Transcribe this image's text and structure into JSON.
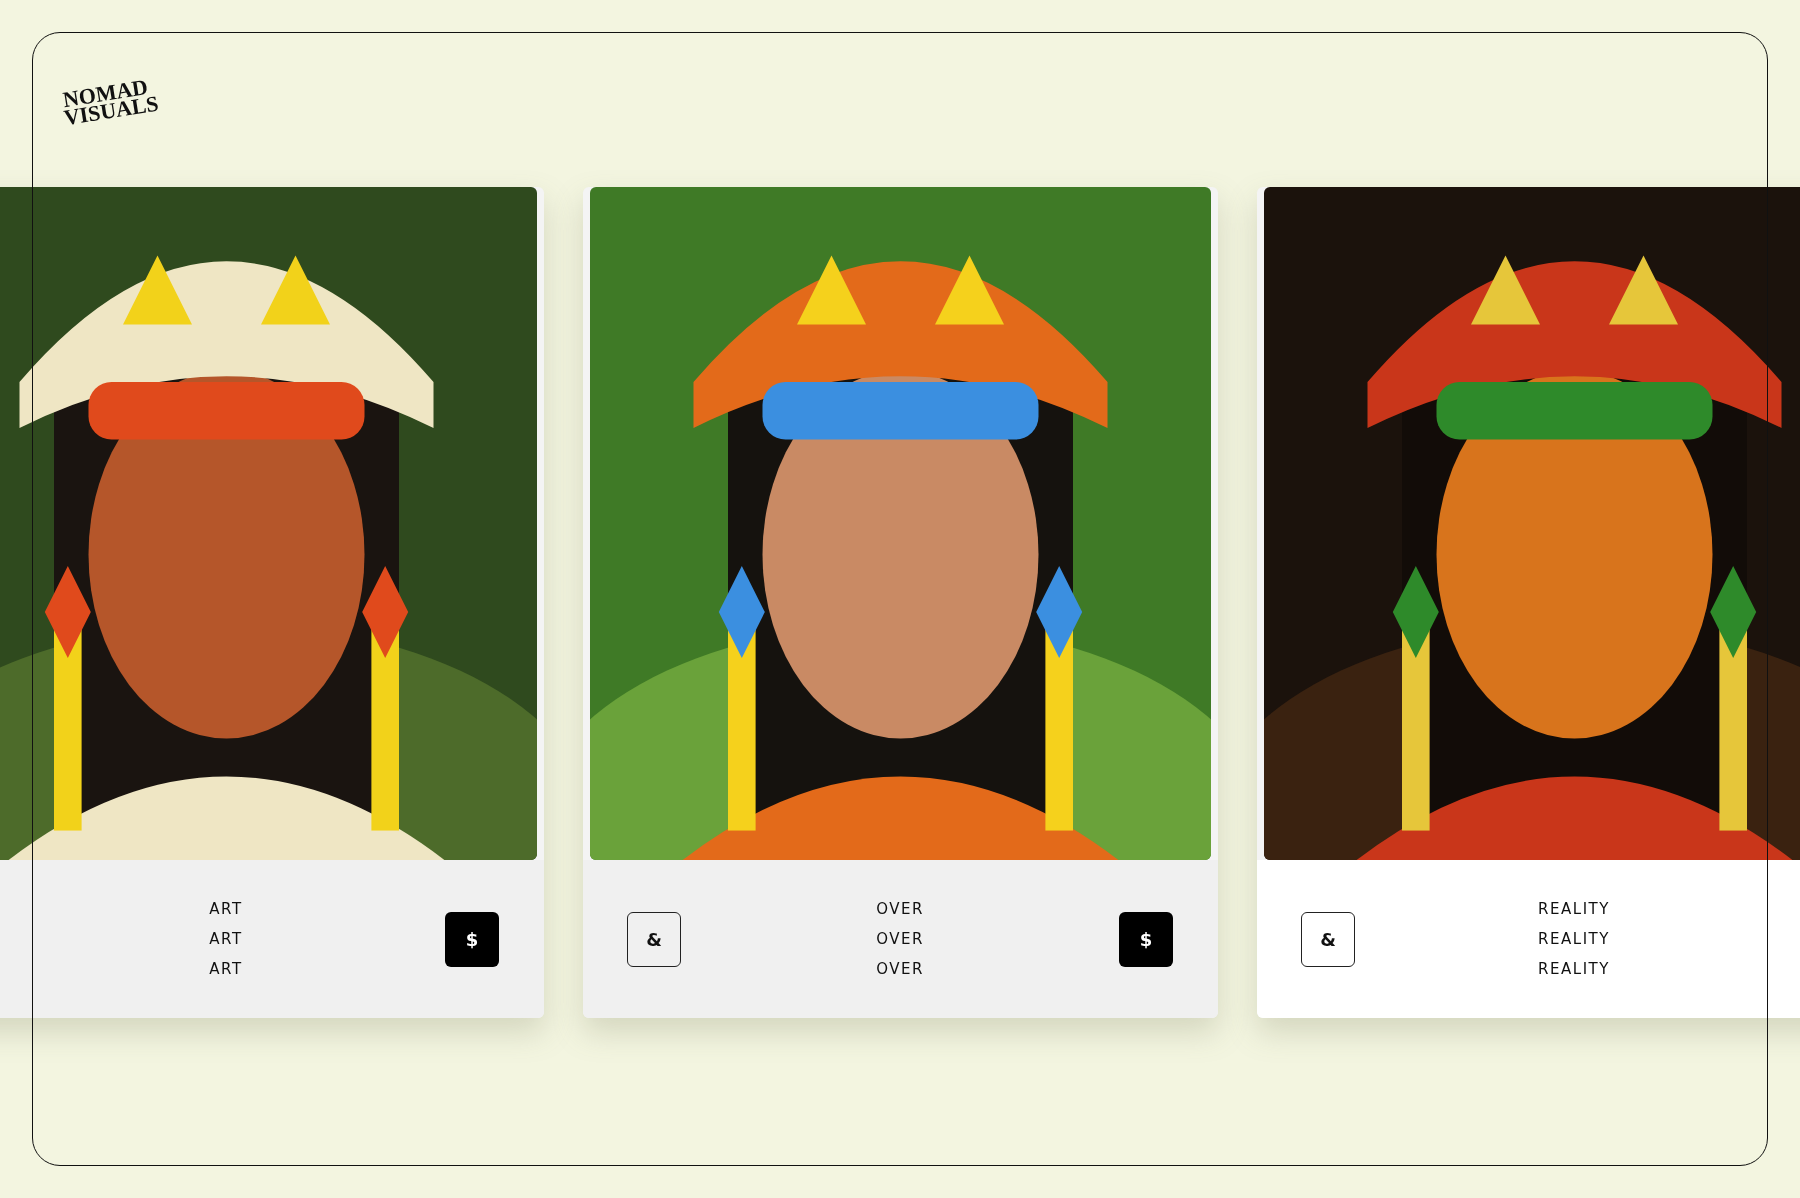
{
  "logo": {
    "lines": [
      "NOMAD",
      "VISUALS"
    ]
  },
  "cards": [
    {
      "image": {
        "kind": "picture"
      },
      "labels": [
        "ART",
        "ART",
        "ART"
      ],
      "highlighted": false,
      "buttons": [
        {
          "kind": "filled",
          "label": "$"
        }
      ]
    },
    {
      "image": {
        "kind": "picture"
      },
      "labels": [
        "OVER",
        "OVER",
        "OVER"
      ],
      "highlighted": false,
      "buttons": [
        {
          "kind": "outline",
          "label": "&"
        },
        {
          "kind": "filled",
          "label": "$"
        }
      ]
    },
    {
      "image": {
        "kind": "picture"
      },
      "labels": [
        "REALITY",
        "REALITY",
        "REALITY"
      ],
      "highlighted": true,
      "buttons": [
        {
          "kind": "outline",
          "label": "&"
        }
      ]
    }
  ]
}
